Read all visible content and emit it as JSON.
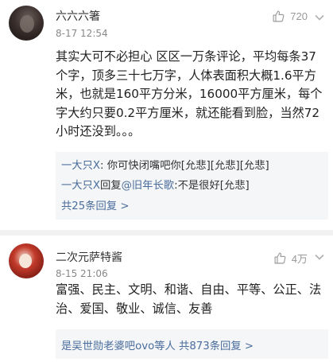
{
  "comments": [
    {
      "username": "六六六箸",
      "time": "8-17 12:54",
      "likes": "720",
      "text": "其实大可不必担心 区区一万条评论，平均每条37个字，顶多三十七万字，人体表面积大概1.6平方米，也就是160平方分米，16000平方厘米，每个字大约只要0.2平方厘米，就还能看到脸，当然72小时还没到。。。",
      "replies": [
        {
          "user": "一大只X",
          "sep": ": ",
          "text": "你可快闭嘴吧你[允悲][允悲][允悲]"
        },
        {
          "user": "一大只X",
          "verb": "回复",
          "target": "@旧年长歌",
          "sep": ":",
          "text": "不是很好[允悲]"
        }
      ],
      "view_all": "共25条回复 >"
    },
    {
      "username": "二次元萨特酱",
      "time": "8-15 21:06",
      "likes": "4万",
      "text": "富强、民主、文明、和谐、自由、平等、公正、法治、爱国、敬业、诚信、友善",
      "summary": "是吴世勋老婆吧ovo等人  共873条回复 >"
    }
  ],
  "icons": {
    "like": "thumbs-up-icon",
    "more": "chevron-down-icon"
  },
  "colors": {
    "link": "#4a6d9c",
    "reply_bg": "#f5f6f8",
    "muted": "#999999"
  }
}
